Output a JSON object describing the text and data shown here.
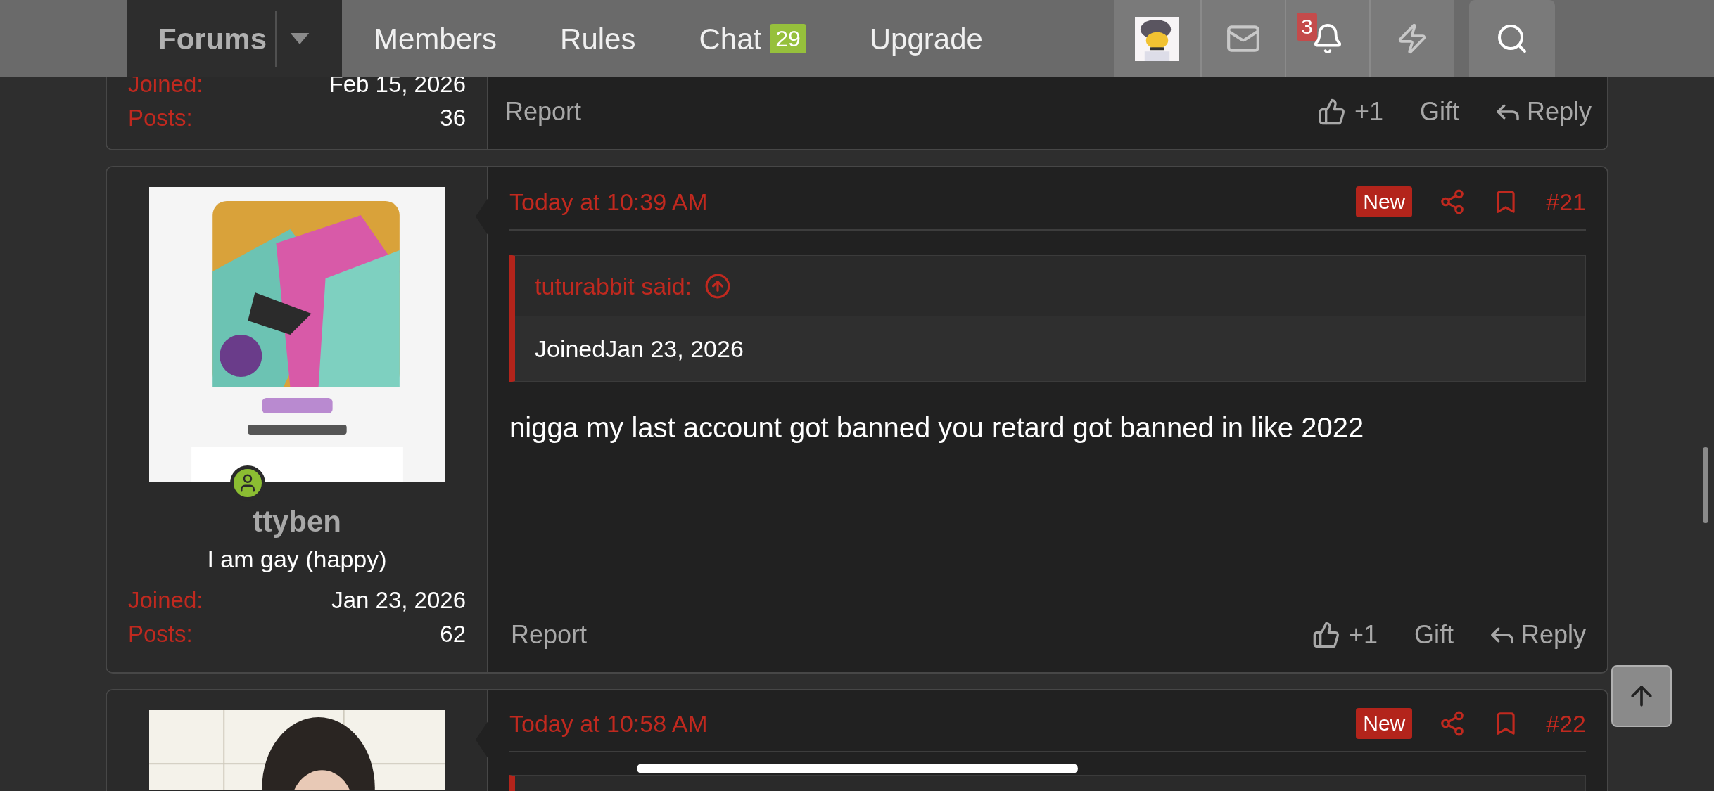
{
  "nav": {
    "items": [
      {
        "label": "Forums",
        "selected": true,
        "dropdown": true
      },
      {
        "label": "Members",
        "selected": false
      },
      {
        "label": "Rules",
        "selected": false
      },
      {
        "label": "Chat",
        "selected": false,
        "badge": "29"
      },
      {
        "label": "Upgrade",
        "selected": false
      }
    ],
    "alerts_badge": "3"
  },
  "posts": [
    {
      "user": {
        "stats": [
          {
            "label": "Joined:",
            "value": "Feb 15, 2026"
          },
          {
            "label": "Posts:",
            "value": "36"
          }
        ]
      },
      "actions": {
        "report": "Report",
        "like": "+1",
        "gift": "Gift",
        "reply": "Reply"
      }
    },
    {
      "user": {
        "online": true,
        "name": "ttyben",
        "title": "I am gay (happy)",
        "stats": [
          {
            "label": "Joined:",
            "value": "Jan 23, 2026"
          },
          {
            "label": "Posts:",
            "value": "62"
          }
        ]
      },
      "time": "Today at 10:39 AM",
      "badge": "New",
      "number": "#21",
      "quote": {
        "author": "tuturabbit said:",
        "text": "JoinedJan 23, 2026"
      },
      "message": "nigga my last account got banned you retard got banned in like 2022",
      "actions": {
        "report": "Report",
        "like": "+1",
        "gift": "Gift",
        "reply": "Reply"
      }
    },
    {
      "time": "Today at 10:58 AM",
      "badge": "New",
      "number": "#22",
      "quote_start": true
    }
  ]
}
